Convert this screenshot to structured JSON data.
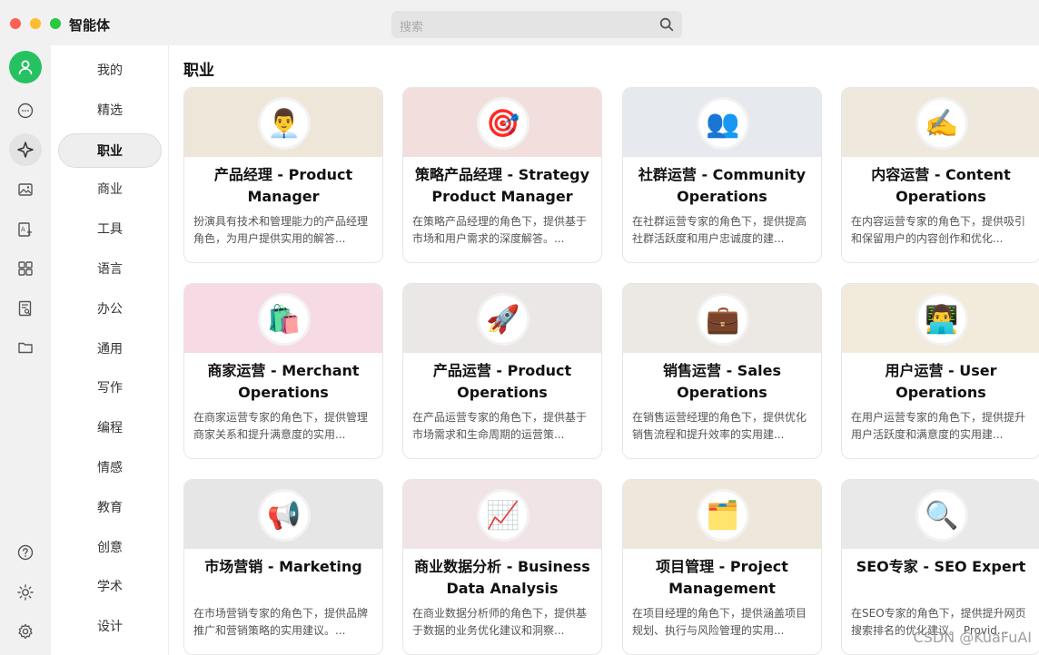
{
  "app": {
    "title": "智能体"
  },
  "search": {
    "placeholder": "搜索"
  },
  "iconbar": {
    "top": [
      {
        "name": "user-avatar-icon"
      },
      {
        "name": "chat-bubble-icon"
      },
      {
        "name": "sparkle-agent-icon",
        "active": true
      },
      {
        "name": "image-icon"
      },
      {
        "name": "image-text-icon"
      },
      {
        "name": "grid-apps-icon"
      },
      {
        "name": "document-search-icon"
      },
      {
        "name": "folder-icon"
      }
    ],
    "bottom": [
      {
        "name": "help-icon"
      },
      {
        "name": "theme-sun-icon"
      },
      {
        "name": "settings-gear-icon"
      }
    ]
  },
  "categories": [
    "我的",
    "精选",
    "职业",
    "商业",
    "工具",
    "语言",
    "办公",
    "通用",
    "写作",
    "编程",
    "情感",
    "教育",
    "创意",
    "学术",
    "设计"
  ],
  "active_category": "职业",
  "section": {
    "title": "职业"
  },
  "cards": [
    {
      "title": "产品经理 - Product Manager",
      "desc": "扮演具有技术和管理能力的产品经理角色，为用户提供实用的解答...",
      "emoji": "👨‍💼",
      "banner": "#efe6da"
    },
    {
      "title": "策略产品经理 - Strategy Product Manager",
      "desc": "在策略产品经理的角色下，提供基于市场和用户需求的深度解答。...",
      "emoji": "🎯",
      "banner": "#f3dede"
    },
    {
      "title": "社群运营 - Community Operations",
      "desc": "在社群运营专家的角色下，提供提高社群活跃度和用户忠诚度的建...",
      "emoji": "👥",
      "banner": "#e6e9ee"
    },
    {
      "title": "内容运营 - Content Operations",
      "desc": "在内容运营专家的角色下，提供吸引和保留用户的内容创作和优化...",
      "emoji": "✍️",
      "banner": "#efe8dc"
    },
    {
      "title": "商家运营 - Merchant Operations",
      "desc": "在商家运营专家的角色下，提供管理商家关系和提升满意度的实用...",
      "emoji": "🛍️",
      "banner": "#f7dbe4"
    },
    {
      "title": "产品运营 - Product Operations",
      "desc": "在产品运营专家的角色下，提供基于市场需求和生命周期的运营策...",
      "emoji": "🚀",
      "banner": "#ebe7e7"
    },
    {
      "title": "销售运营 - Sales Operations",
      "desc": "在销售运营经理的角色下，提供优化销售流程和提升效率的实用建...",
      "emoji": "💼",
      "banner": "#ece8e4"
    },
    {
      "title": "用户运营 - User Operations",
      "desc": "在用户运营专家的角色下，提供提升用户活跃度和满意度的实用建...",
      "emoji": "👨‍💻",
      "banner": "#f2ebdc"
    },
    {
      "title": "市场营销 - Marketing",
      "desc": "在市场营销专家的角色下，提供品牌推广和营销策略的实用建议。...",
      "emoji": "📢",
      "banner": "#e6e6e6"
    },
    {
      "title": "商业数据分析 - Business Data Analysis",
      "desc": "在商业数据分析师的角色下，提供基于数据的业务优化建议和洞察...",
      "emoji": "📈",
      "banner": "#f1e4e6"
    },
    {
      "title": "项目管理 - Project Management",
      "desc": "在项目经理的角色下，提供涵盖项目规划、执行与风险管理的实用...",
      "emoji": "🗂️",
      "banner": "#efe7dc"
    },
    {
      "title": "SEO专家 - SEO Expert",
      "desc": "在SEO专家的角色下，提供提升网页搜索排名的优化建议。 Provid...",
      "emoji": "🔍",
      "banner": "#e9e9e9"
    }
  ],
  "watermark": "CSDN @KuaFuAI"
}
